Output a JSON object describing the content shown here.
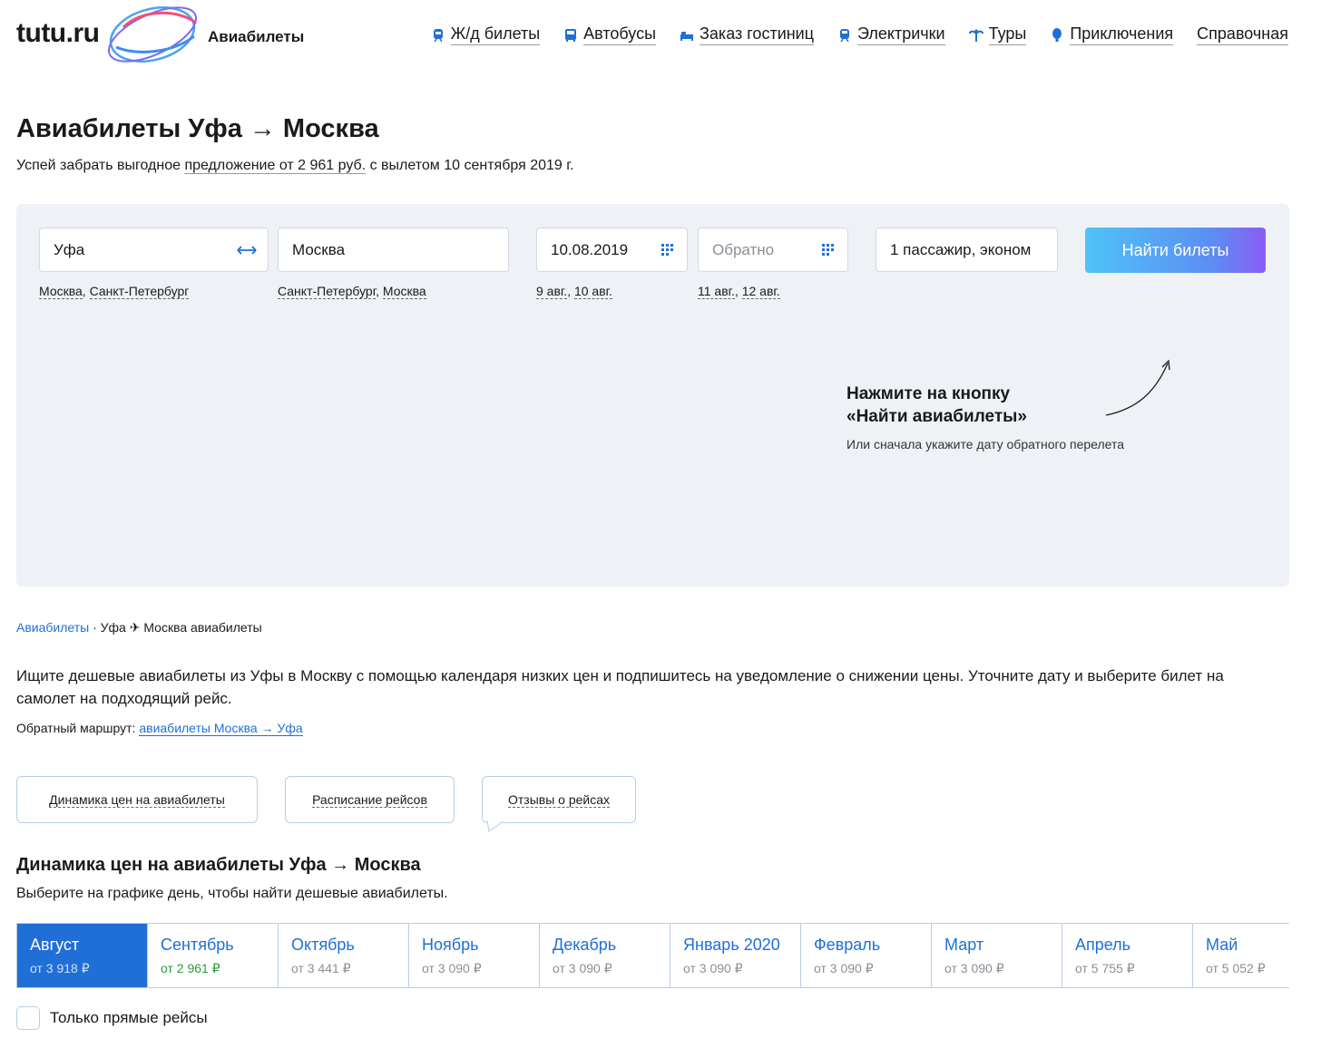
{
  "header": {
    "logo": "tutu.ru",
    "section": "Авиабилеты",
    "nav": [
      {
        "label": "Ж/д билеты",
        "icon": "train-icon"
      },
      {
        "label": "Автобусы",
        "icon": "bus-icon"
      },
      {
        "label": "Заказ гостиниц",
        "icon": "bed-icon"
      },
      {
        "label": "Электрички",
        "icon": "suburban-train-icon"
      },
      {
        "label": "Туры",
        "icon": "palm-icon"
      },
      {
        "label": "Приключения",
        "icon": "balloon-icon"
      },
      {
        "label": "Справочная",
        "icon": ""
      }
    ]
  },
  "title": "Авиабилеты Уфа → Москва",
  "subtitle": {
    "before": "Успей забрать выгодное ",
    "offer": "предложение от 2 961 руб.",
    "after": " с вылетом 10 сентября 2019 г."
  },
  "search": {
    "from": "Уфа",
    "to": "Москва",
    "date": "10.08.2019",
    "return_placeholder": "Обратно",
    "passengers": "1 пассажир, эконом",
    "button": "Найти билеты",
    "hints_from": [
      "Москва",
      "Санкт-Петербург"
    ],
    "hints_to": [
      "Санкт-Петербург",
      "Москва"
    ],
    "hints_date": [
      "9 авг.",
      "10 авг."
    ],
    "hints_return": [
      "11 авг.",
      "12 авг."
    ],
    "cta_line1": "Нажмите на кнопку",
    "cta_line2": "«Найти авиабилеты»",
    "cta_sub": "Или сначала укажите дату обратного перелета"
  },
  "breadcrumb": {
    "link": "Авиабилеты",
    "sep": " · ",
    "current": "Уфа ✈ Москва авиабилеты"
  },
  "description": "Ищите дешевые авиабилеты из Уфы в Москву с помощью календаря низких цен и подпишитесь на уведомление о снижении цены. Уточните дату и выберите билет на самолет на подходящий рейс.",
  "reverse": {
    "label": "Обратный маршрут: ",
    "link": "авиабилеты Москва → Уфа"
  },
  "tabs": [
    "Динамика цен на авиабилеты",
    "Расписание рейсов",
    "Отзывы о рейсах"
  ],
  "dynamics": {
    "title": "Динамика цен на авиабилеты Уфа → Москва",
    "subtitle": "Выберите на графике день, чтобы найти дешевые авиабилеты.",
    "months": [
      {
        "name": "Август",
        "price": "от 3 918 ₽",
        "active": true
      },
      {
        "name": "Сентябрь",
        "price": "от 2 961 ₽",
        "cheapest": true
      },
      {
        "name": "Октябрь",
        "price": "от 3 441 ₽"
      },
      {
        "name": "Ноябрь",
        "price": "от 3 090 ₽"
      },
      {
        "name": "Декабрь",
        "price": "от 3 090 ₽"
      },
      {
        "name": "Январь 2020",
        "price": "от 3 090 ₽"
      },
      {
        "name": "Февраль",
        "price": "от 3 090 ₽"
      },
      {
        "name": "Март",
        "price": "от 3 090 ₽"
      },
      {
        "name": "Апрель",
        "price": "от 5 755 ₽"
      },
      {
        "name": "Май",
        "price": "от 5 052 ₽"
      }
    ],
    "direct_only": "Только прямые рейсы"
  },
  "colors": {
    "accent": "#1f6fd6",
    "button_gradient_start": "#4fc3f7",
    "button_gradient_end": "#8b5cf6",
    "panel_bg": "#eef1f6",
    "cheapest": "#2a9d3a"
  }
}
